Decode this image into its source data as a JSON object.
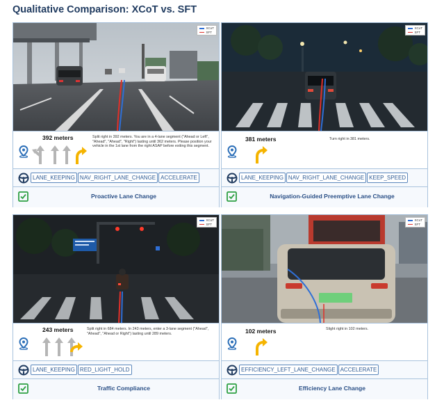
{
  "title": "Qualitative Comparison: XCoT vs. SFT",
  "legend": {
    "xcot_label": "XCoT",
    "sft_label": "SFT",
    "xcot_color": "#2f6fd6",
    "sft_color": "#e0302a"
  },
  "panels": [
    {
      "distance": "392 meters",
      "description": "Split right in 392 meters. You are in a 4-lane segment (\"Ahead or Left\", \"Ahead\", \"Ahead\", \"Right\") lasting until 362 meters. Please position your vehicle in the 1st lane from the right ASAP before exiting this segment.",
      "lane_arrows": [
        "ahead-or-left",
        "ahead",
        "ahead",
        "right"
      ],
      "actions": [
        "LANE_KEEPING",
        "NAV_RIGHT_LANE_CHANGE",
        "ACCELERATE"
      ],
      "verdict": "Proactive Lane Change"
    },
    {
      "distance": "381 meters",
      "description": "Turn right in 381 meters.",
      "lane_arrows": [
        "right"
      ],
      "actions": [
        "LANE_KEEPING",
        "NAV_RIGHT_LANE_CHANGE",
        "KEEP_SPEED"
      ],
      "verdict": "Navigation-Guided Preemptive Lane Change"
    },
    {
      "distance": "243 meters",
      "description": "Split right in 684 meters. In 243 meters, enter a 3-lane segment (\"Ahead\", \"Ahead\", \"Ahead or Right\") lasting until 289 meters.",
      "lane_arrows": [
        "ahead",
        "ahead",
        "ahead-or-right"
      ],
      "actions": [
        "LANE_KEEPING",
        "RED_LIGHT_HOLD"
      ],
      "verdict": "Traffic Compliance"
    },
    {
      "distance": "102 meters",
      "description": "Slight right in 102 meters.",
      "lane_arrows": [
        "right"
      ],
      "actions": [
        "EFFICIENCY_LEFT_LANE_CHANGE",
        "ACCELERATE"
      ],
      "verdict": "Efficiency Lane Change"
    }
  ],
  "icons": {
    "pin": "map-pin-icon",
    "wheel": "steering-wheel-icon",
    "check": "check-box-icon",
    "arrow_gray": "#b5b5b5",
    "arrow_active": "#f5b400",
    "green": "#2ea043"
  }
}
